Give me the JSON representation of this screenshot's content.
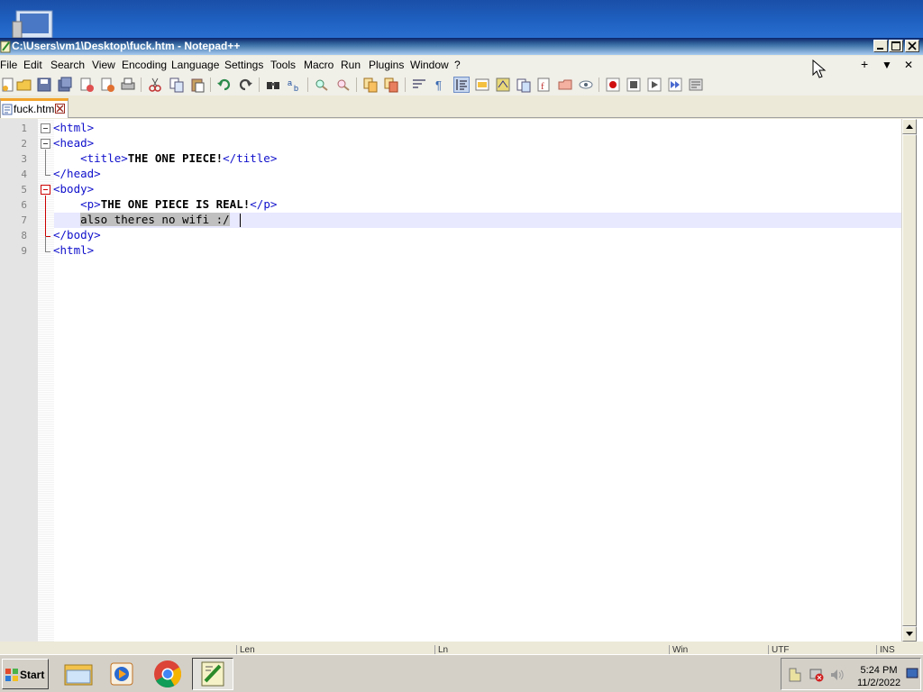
{
  "window": {
    "title": "C:\\Users\\vm1\\Desktop\\fuck.htm - Notepad++"
  },
  "menu": {
    "items": [
      "File",
      "Edit",
      "Search",
      "View",
      "Encoding",
      "Language",
      "Settings",
      "Tools",
      "Macro",
      "Run",
      "Plugins",
      "Window",
      "?"
    ],
    "right": [
      "+",
      "▼",
      "✕"
    ]
  },
  "tab": {
    "label": "fuck.htm"
  },
  "editor": {
    "line_numbers": [
      "1",
      "2",
      "3",
      "4",
      "5",
      "6",
      "7",
      "8",
      "9"
    ],
    "lines": [
      {
        "indent": "",
        "parts": [
          {
            "k": "tag",
            "t": "<html>"
          }
        ]
      },
      {
        "indent": "",
        "parts": [
          {
            "k": "tag",
            "t": "<head>"
          }
        ]
      },
      {
        "indent": "    ",
        "parts": [
          {
            "k": "tag",
            "t": "<title>"
          },
          {
            "k": "txt",
            "t": "THE ONE PIECE!"
          },
          {
            "k": "tag",
            "t": "</title>"
          }
        ]
      },
      {
        "indent": "",
        "parts": [
          {
            "k": "tag",
            "t": "</head>"
          }
        ]
      },
      {
        "indent": "",
        "parts": [
          {
            "k": "tag",
            "t": "<body>"
          }
        ]
      },
      {
        "indent": "    ",
        "parts": [
          {
            "k": "tag",
            "t": "<p>"
          },
          {
            "k": "txt",
            "t": "THE ONE PIECE IS REAL!"
          },
          {
            "k": "tag",
            "t": "</p>"
          }
        ]
      },
      {
        "indent": "    ",
        "parts": [
          {
            "k": "sel",
            "t": "also theres no wifi :/"
          }
        ]
      },
      {
        "indent": "",
        "parts": [
          {
            "k": "tag",
            "t": "</body>"
          }
        ]
      },
      {
        "indent": "",
        "parts": [
          {
            "k": "tag",
            "t": "<html>"
          }
        ]
      }
    ]
  },
  "statusbar": {
    "cells": [
      "",
      "Len",
      "Ln",
      "Win",
      "UTF",
      "INS"
    ]
  },
  "taskbar": {
    "start_label": "Start",
    "time": "5:24 PM",
    "date": "11/2/2022"
  },
  "colors": {
    "tag": "#1010cc",
    "current_line": "#e8e8ff",
    "selection": "#c0c0c0",
    "tab_accent": "#f2a42c"
  }
}
